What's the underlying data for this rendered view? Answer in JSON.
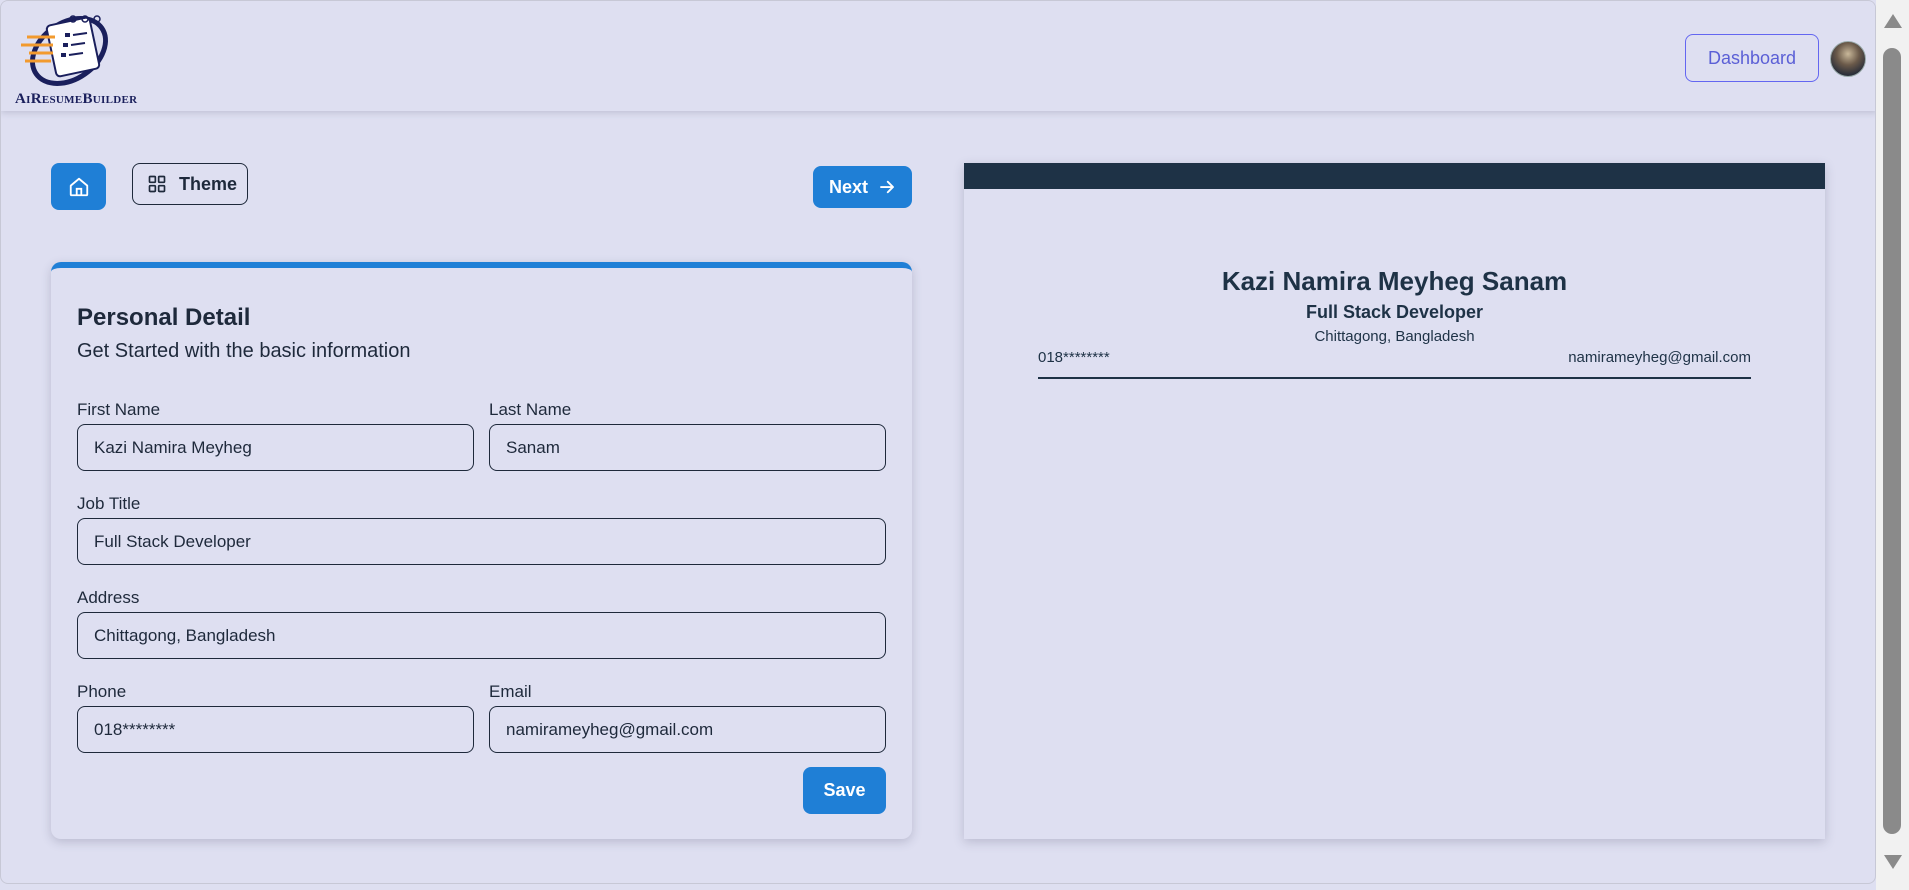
{
  "header": {
    "logo_text": "AiResumeBuilder",
    "dashboard_label": "Dashboard"
  },
  "toolbar": {
    "theme_label": "Theme",
    "next_label": "Next"
  },
  "form": {
    "title": "Personal Detail",
    "subtitle": "Get Started with the basic information",
    "first_name": {
      "label": "First Name",
      "value": "Kazi Namira Meyheg"
    },
    "last_name": {
      "label": "Last Name",
      "value": "Sanam"
    },
    "job_title": {
      "label": "Job Title",
      "value": "Full Stack Developer"
    },
    "address": {
      "label": "Address",
      "value": "Chittagong, Bangladesh"
    },
    "phone": {
      "label": "Phone",
      "value": "018********"
    },
    "email": {
      "label": "Email",
      "value": "namirameyheg@gmail.com"
    },
    "save_label": "Save"
  },
  "preview": {
    "name": "Kazi Namira Meyheg Sanam",
    "job_title": "Full Stack Developer",
    "address": "Chittagong, Bangladesh",
    "phone": "018********",
    "email": "namirameyheg@gmail.com",
    "theme_color": "#1e3246"
  },
  "colors": {
    "primary": "#1f7fd6",
    "background": "#dedff1",
    "dashboard_accent": "#6366f1"
  },
  "icons": {
    "home": "home-icon",
    "theme": "grid-icon",
    "next": "arrow-right-icon"
  }
}
